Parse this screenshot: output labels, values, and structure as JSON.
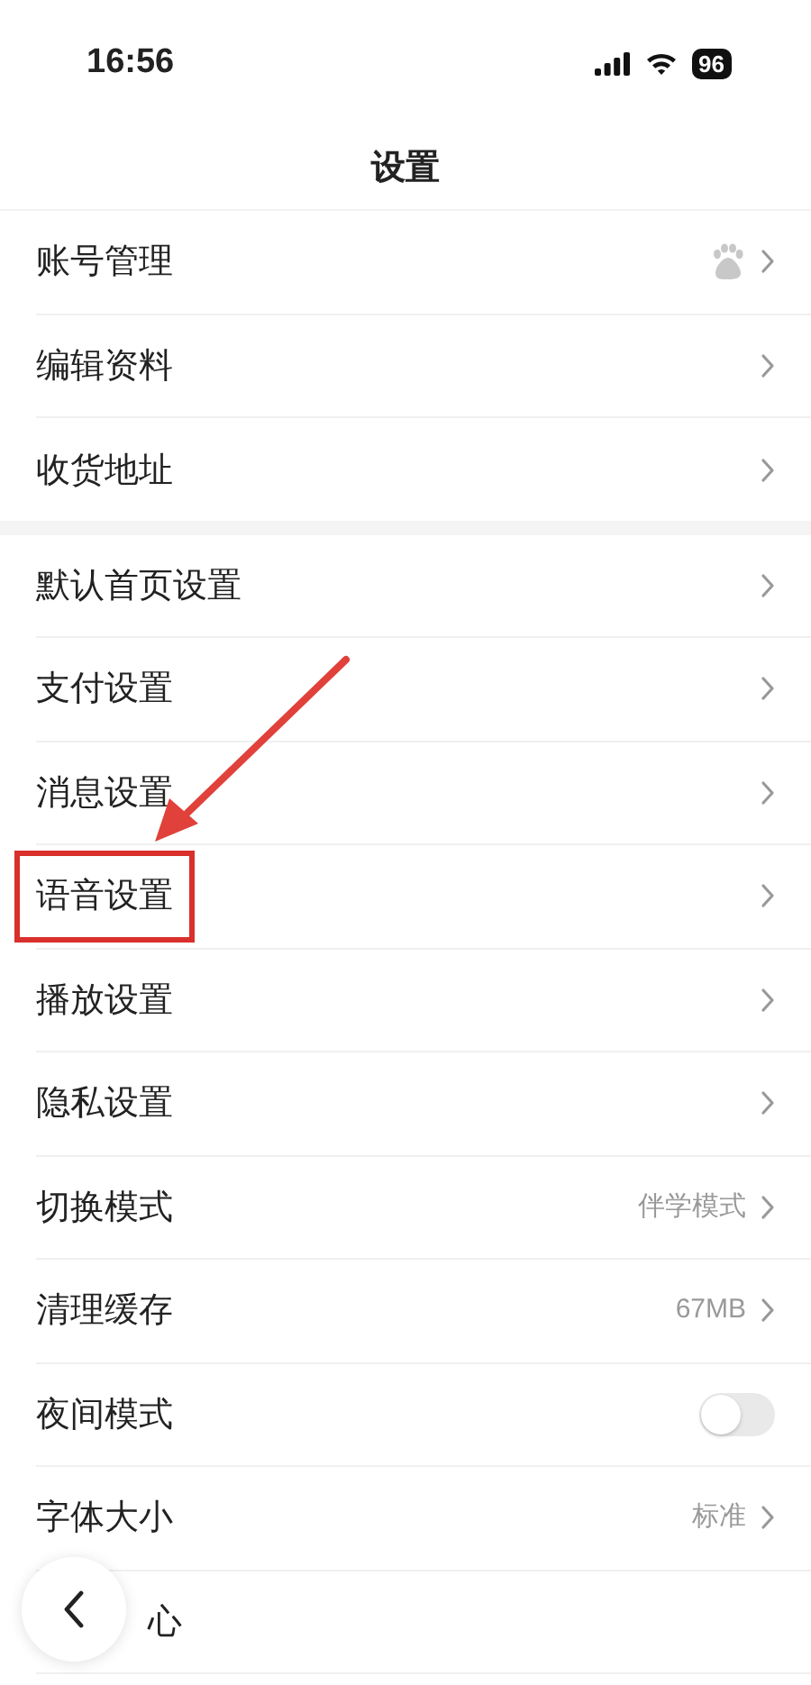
{
  "status_bar": {
    "time": "16:56",
    "battery": "96"
  },
  "title": "设置",
  "sections": [
    {
      "items": [
        {
          "label": "账号管理",
          "kind": "icon"
        },
        {
          "label": "编辑资料",
          "kind": "link"
        },
        {
          "label": "收货地址",
          "kind": "link"
        }
      ]
    },
    {
      "items": [
        {
          "label": "默认首页设置",
          "kind": "link"
        },
        {
          "label": "支付设置",
          "kind": "link"
        },
        {
          "label": "消息设置",
          "kind": "link"
        },
        {
          "label": "语音设置",
          "kind": "link",
          "highlighted": true
        },
        {
          "label": "播放设置",
          "kind": "link"
        },
        {
          "label": "隐私设置",
          "kind": "link"
        },
        {
          "label": "切换模式",
          "kind": "link",
          "value": "伴学模式"
        },
        {
          "label": "清理缓存",
          "kind": "link",
          "value": "67MB"
        },
        {
          "label": "夜间模式",
          "kind": "toggle",
          "on": false
        },
        {
          "label": "字体大小",
          "kind": "link",
          "value": "标准"
        },
        {
          "label": "心",
          "kind": "covered"
        }
      ]
    }
  ]
}
